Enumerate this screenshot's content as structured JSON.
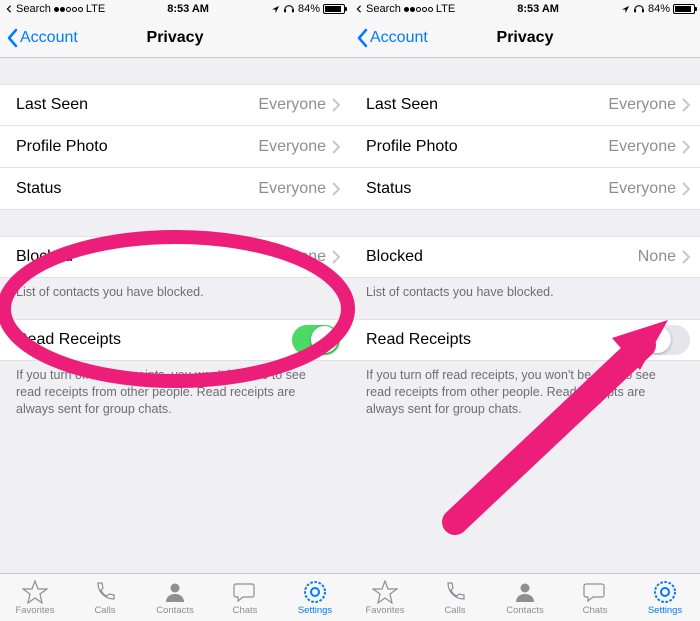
{
  "status_bar": {
    "back_to_app": "Search",
    "carrier": "LTE",
    "time": "8:53 AM",
    "battery_pct": "84%"
  },
  "nav": {
    "back_label": "Account",
    "title": "Privacy"
  },
  "rows": {
    "last_seen": {
      "label": "Last Seen",
      "value": "Everyone"
    },
    "profile_photo": {
      "label": "Profile Photo",
      "value": "Everyone"
    },
    "status": {
      "label": "Status",
      "value": "Everyone"
    },
    "blocked": {
      "label": "Blocked",
      "value": "None"
    },
    "read_receipts": {
      "label": "Read Receipts"
    }
  },
  "footers": {
    "blocked": "List of contacts you have blocked.",
    "read_receipts": "If you turn off read receipts, you won't be able to see read receipts from other people. Read receipts are always sent for group chats."
  },
  "tabs": {
    "favorites": "Favorites",
    "calls": "Calls",
    "contacts": "Contacts",
    "chats": "Chats",
    "settings": "Settings"
  },
  "panels": {
    "left": {
      "read_receipts_on": true
    },
    "right": {
      "read_receipts_on": false
    }
  },
  "annotation": {
    "accent": "#ec1e79"
  }
}
